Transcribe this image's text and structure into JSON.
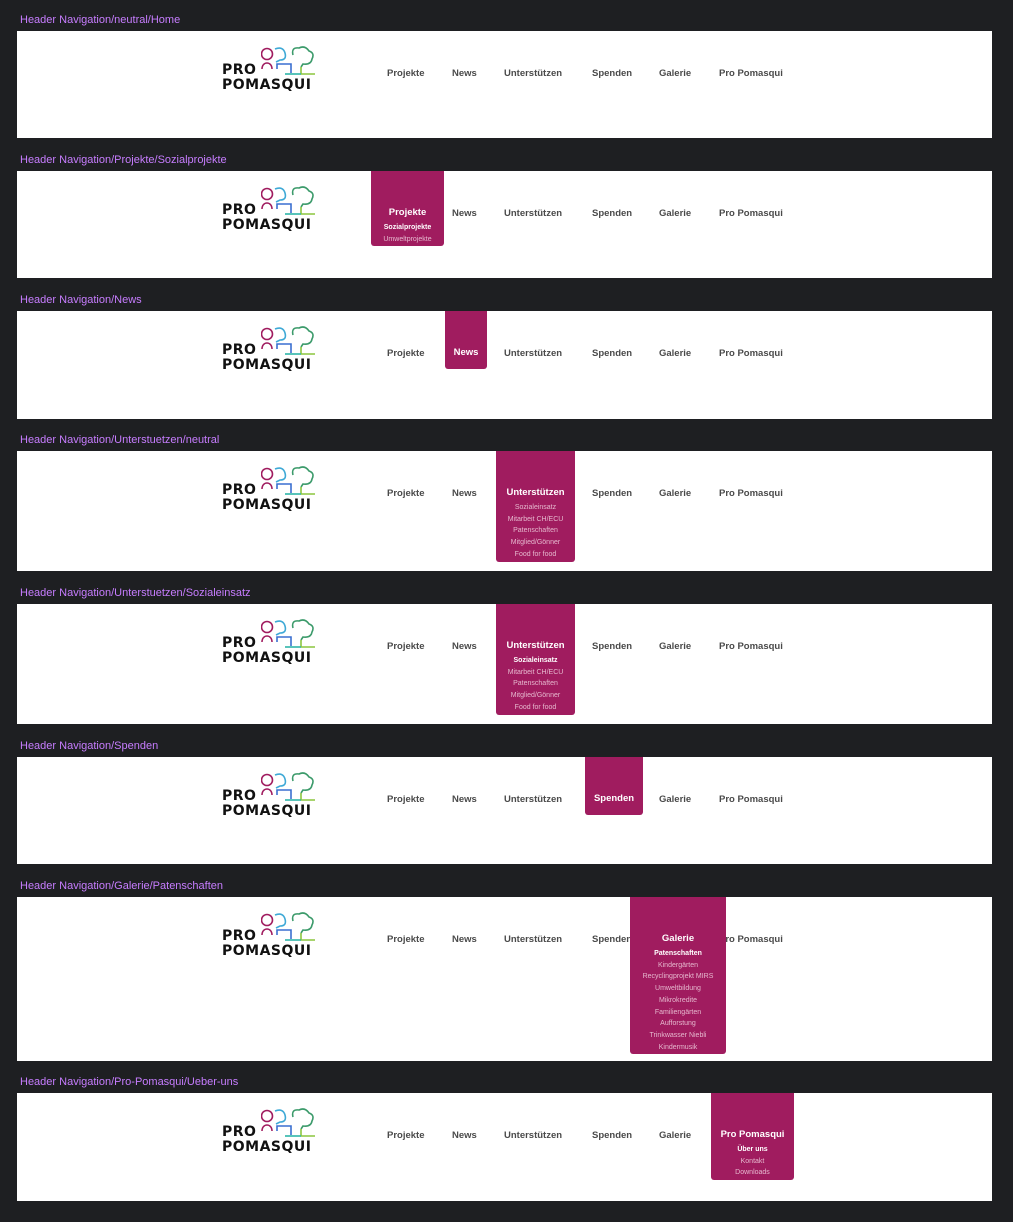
{
  "logo": {
    "line1": "PRO",
    "line2": "POMASQUI"
  },
  "nav_labels": [
    "Projekte",
    "News",
    "Unterstützen",
    "Spenden",
    "Galerie",
    "Pro Pomasqui"
  ],
  "colors": {
    "accent": "#a01c5f",
    "background": "#1e1f22",
    "label": "#c77dff"
  },
  "variants": [
    {
      "label": "Header Navigation/neutral/Home",
      "active": null,
      "subitems": [],
      "active_sub": null
    },
    {
      "label": "Header Navigation/Projekte/Sozialprojekte",
      "active": 0,
      "subitems": [
        "Sozialprojekte",
        "Umweltprojekte"
      ],
      "active_sub": 0
    },
    {
      "label": "Header Navigation/News",
      "active": 1,
      "subitems": [],
      "active_sub": null
    },
    {
      "label": "Header Navigation/Unterstuetzen/neutral",
      "active": 2,
      "subitems": [
        "Sozialeinsatz",
        "Mitarbeit CH/ECU",
        "Patenschaften",
        "Mitglied/Gönner",
        "Food for food"
      ],
      "active_sub": null
    },
    {
      "label": "Header Navigation/Unterstuetzen/Sozialeinsatz",
      "active": 2,
      "subitems": [
        "Sozialeinsatz",
        "Mitarbeit CH/ECU",
        "Patenschaften",
        "Mitglied/Gönner",
        "Food for food"
      ],
      "active_sub": 0
    },
    {
      "label": "Header Navigation/Spenden",
      "active": 3,
      "subitems": [],
      "active_sub": null
    },
    {
      "label": "Header Navigation/Galerie/Patenschaften",
      "active": 4,
      "subitems": [
        "Patenschaften",
        "Kindergärten",
        "Recyclingprojekt MIRS",
        "Umweltbildung",
        "Mikrokredite",
        "Familiengärten",
        "Aufforstung",
        "Trinkwasser Niebli",
        "Kindermusik"
      ],
      "active_sub": 0
    },
    {
      "label": "Header Navigation/Pro-Pomasqui/Ueber-uns",
      "active": 5,
      "subitems": [
        "Über uns",
        "Kontakt",
        "Downloads"
      ],
      "active_sub": 0
    }
  ]
}
